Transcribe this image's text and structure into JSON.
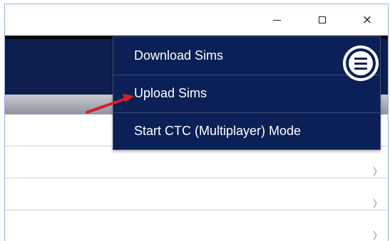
{
  "window_controls": {
    "minimize_icon": "minimize-icon",
    "maximize_icon": "maximize-icon",
    "close_glyph": "×"
  },
  "menu": {
    "items": [
      {
        "label": "Download Sims"
      },
      {
        "label": "Upload Sims"
      },
      {
        "label": "Start CTC (Multiplayer) Mode"
      }
    ],
    "button_icon": "hamburger-menu-icon"
  },
  "list": {
    "chevron_glyph": "〉"
  },
  "colors": {
    "menu_bg": "#0a2056",
    "header_bg": "#0d1f4c",
    "annotation_arrow": "#d3202a"
  }
}
